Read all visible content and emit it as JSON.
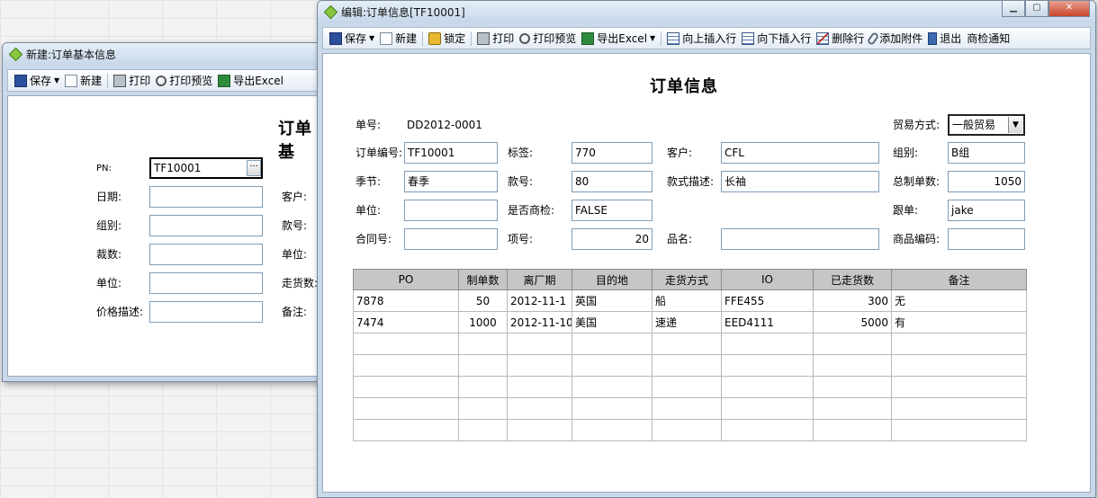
{
  "back_window": {
    "title": "新建:订单基本信息",
    "toolbar": {
      "save": "保存",
      "new": "新建",
      "print": "打印",
      "print_preview": "打印预览",
      "export_excel": "导出Excel"
    },
    "form_title_partial": "订单基",
    "fields": {
      "pn_label": "PN:",
      "pn_value": "TF10001",
      "date_label": "日期:",
      "group_label": "组别:",
      "cut_qty_label": "裁数:",
      "unit_label": "单位:",
      "price_desc_label": "价格描述:",
      "customer_label": "客户:",
      "style_no_label": "款号:",
      "unit2_label": "单位:",
      "shipped_label": "走货数:",
      "remark_label": "备注:"
    }
  },
  "front_window": {
    "title": "编辑:订单信息[TF10001]",
    "toolbar": {
      "save": "保存",
      "new": "新建",
      "lock": "锁定",
      "print": "打印",
      "print_preview": "打印预览",
      "export_excel": "导出Excel",
      "insert_above": "向上插入行",
      "insert_below": "向下插入行",
      "delete_row": "删除行",
      "add_attachment": "添加附件",
      "exit": "退出",
      "inspection_notice": "商检通知"
    },
    "form_title": "订单信息",
    "fields": {
      "order_no_label": "单号:",
      "order_no_value": "DD2012-0001",
      "trade_mode_label": "贸易方式:",
      "trade_mode_value": "一般贸易",
      "order_code_label": "订单编号:",
      "order_code_value": "TF10001",
      "tag_label": "标签:",
      "tag_value": "770",
      "customer_label": "客户:",
      "customer_value": "CFL",
      "group_label": "组别:",
      "group_value": "B组",
      "season_label": "季节:",
      "season_value": "春季",
      "style_no_label": "款号:",
      "style_no_value": "80",
      "style_desc_label": "款式描述:",
      "style_desc_value": "长袖",
      "total_qty_label": "总制单数:",
      "total_qty_value": "1050",
      "unit_label": "单位:",
      "unit_value": "",
      "inspection_label": "是否商检:",
      "inspection_value": "FALSE",
      "follower_label": "跟单:",
      "follower_value": "jake",
      "contract_label": "合同号:",
      "contract_value": "",
      "item_no_label": "项号:",
      "item_no_value": "20",
      "product_name_label": "品名:",
      "product_name_value": "",
      "product_code_label": "商品编码:",
      "product_code_value": ""
    },
    "grid": {
      "headers": [
        "PO",
        "制单数",
        "离厂期",
        "目的地",
        "走货方式",
        "IO",
        "已走货数",
        "备注"
      ],
      "rows": [
        [
          "7878",
          "50",
          "2012-11-1",
          "英国",
          "船",
          "FFE455",
          "300",
          "无"
        ],
        [
          "7474",
          "1000",
          "2012-11-10",
          "美国",
          "速递",
          "EED4111",
          "5000",
          "有"
        ]
      ],
      "empty_rows": 5
    }
  }
}
